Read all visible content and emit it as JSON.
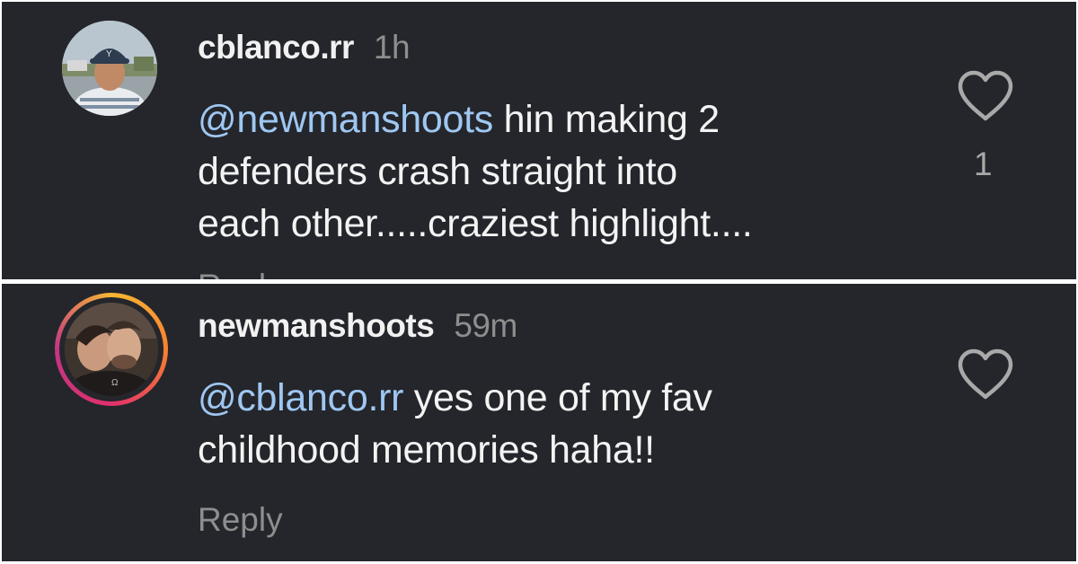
{
  "comments": [
    {
      "username": "cblanco.rr",
      "time": "1h",
      "mention": "@newmanshoots",
      "text_line1": " hin making 2",
      "text_line2": "defenders crash straight into",
      "text_line3": "each other.....craziest highlight....",
      "likes": "1",
      "reply_label": "Reply",
      "avatar_icon": "profile-photo-man-cap"
    },
    {
      "username": "newmanshoots",
      "time": "59m",
      "mention": "@cblanco.rr",
      "text_line1": " yes one of my fav",
      "text_line2": "childhood memories haha!!",
      "reply_label": "Reply",
      "avatar_icon": "profile-photo-couple",
      "story_ring": true
    }
  ],
  "colors": {
    "background": "#24262b",
    "mention": "#9fc7f2",
    "text": "#f3f3f3",
    "muted": "#8e8e8e"
  }
}
